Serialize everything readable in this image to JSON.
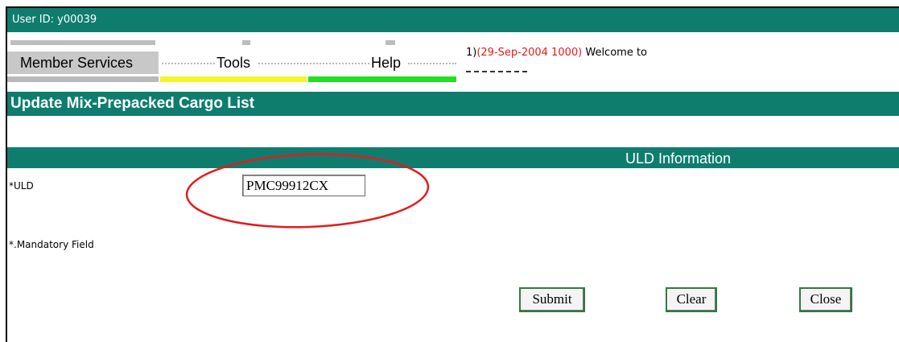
{
  "header": {
    "user_id": "User ID: y00039"
  },
  "menu": {
    "items": [
      {
        "label": "Member Services"
      },
      {
        "label": "Tools"
      },
      {
        "label": "Help"
      }
    ]
  },
  "news": {
    "prefix": "1)",
    "date": "(29-Sep-2004 1000)",
    "text": " Welcome to"
  },
  "page": {
    "title": "Update Mix-Prepacked Cargo List"
  },
  "section": {
    "title": "ULD Information"
  },
  "form": {
    "uld_label": "*ULD",
    "uld_value": "PMC99912CX",
    "mandatory_note": "*.Mandatory Field"
  },
  "actions": {
    "submit": "Submit",
    "clear": "Clear",
    "close": "Close"
  },
  "colors": {
    "header_bg": "#0f7d6e",
    "menu_gray": "#c8c8c8",
    "bar_yellow": "#f4f42a",
    "bar_green": "#21e021",
    "annotation_red": "#e31b1b"
  }
}
